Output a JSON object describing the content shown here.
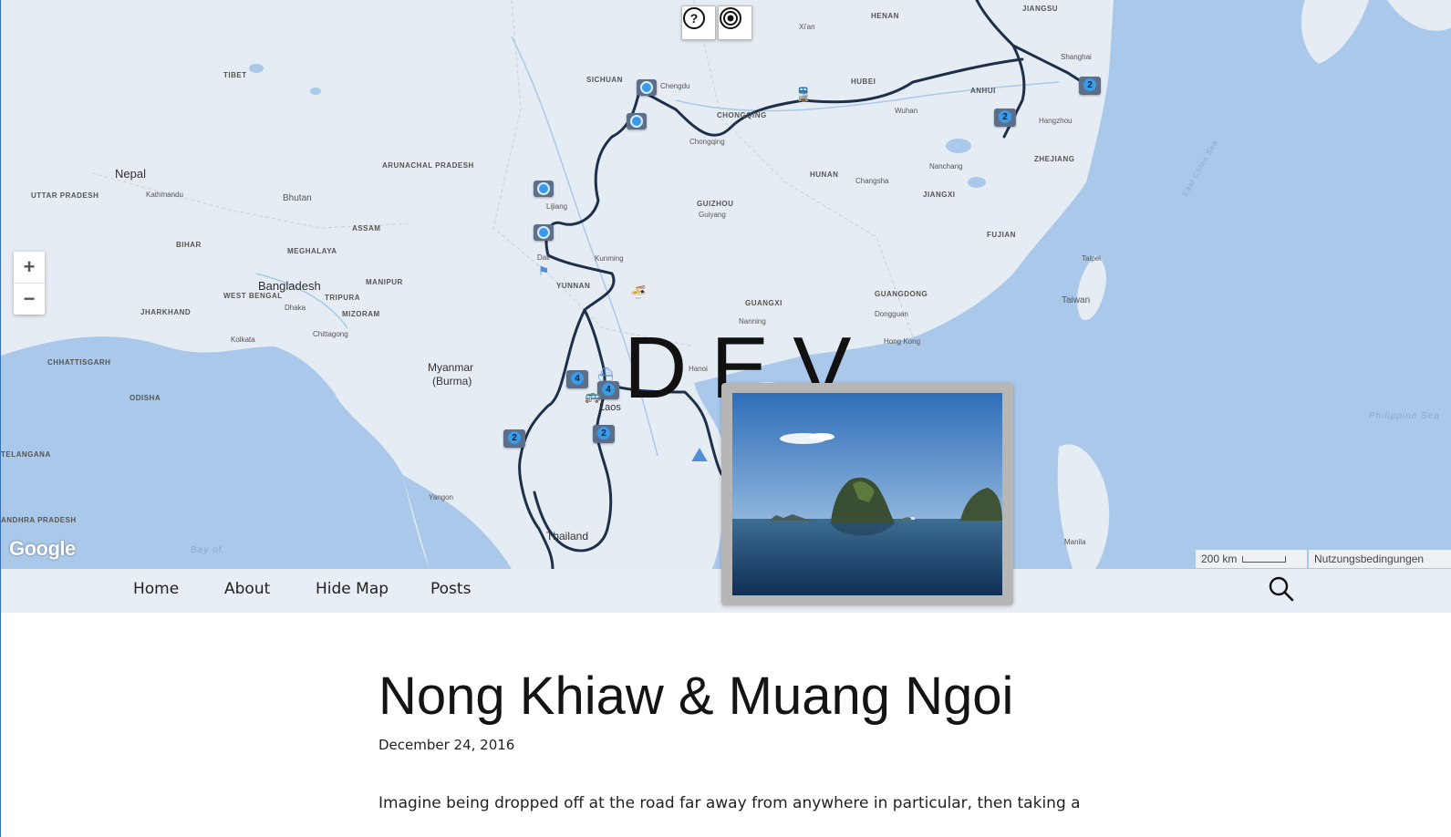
{
  "map": {
    "countries": [
      "Nepal",
      "Bhutan",
      "Bangladesh",
      "Myanmar",
      "(Burma)",
      "Thailand",
      "Laos",
      "Taiwan"
    ],
    "regions": [
      "TIBET",
      "SICHUAN",
      "HENAN",
      "HUBEI",
      "ANHUI",
      "JIANGSU",
      "ZHEJIANG",
      "JIANGXI",
      "HUNAN",
      "FUJIAN",
      "GUIZHOU",
      "YUNNAN",
      "GUANGXI",
      "GUANGDONG",
      "CHONGQING",
      "UTTAR PRADESH",
      "BIHAR",
      "JHARKHAND",
      "WEST BENGAL",
      "ODISHA",
      "CHHATTISGARH",
      "ARUNACHAL PRADESH",
      "ASSAM",
      "MEGHALAYA",
      "MANIPUR",
      "MIZORAM",
      "TRIPURA",
      "ANDHRA PRADESH",
      "TELANGANA"
    ],
    "cities": [
      "Kathmandu",
      "Dhaka",
      "Kolkata",
      "Chittagong",
      "Kunming",
      "Chongqing",
      "Wuhan",
      "Changsha",
      "Nanchang",
      "Hangzhou",
      "Guiyang",
      "Nanning",
      "Hanoi",
      "Hong Kong",
      "Dongguan",
      "Taipei",
      "Yangon",
      "Manila",
      "Chengdu",
      "Shanghai",
      "Xi'an",
      "Lijiang",
      "Dali"
    ],
    "seas": [
      "Bay of",
      "Philippine Sea",
      "East China Sea"
    ],
    "cluster_counts": [
      "2",
      "2",
      "4",
      "4",
      "2",
      "2"
    ],
    "controls": {
      "help_icon": "question-circle-icon",
      "locate_icon": "target-icon",
      "zoom_in": "+",
      "zoom_out": "−"
    },
    "google_logo": "Google",
    "scale_label": "200 km",
    "terms_label": "Nutzungsbedingungen"
  },
  "site": {
    "title": "DEV"
  },
  "nav": {
    "items": [
      "Home",
      "About",
      "Hide Map",
      "Posts"
    ],
    "search_icon": "search-icon"
  },
  "post": {
    "title": "Nong Khiaw & Muang Ngoi",
    "date": "December 24, 2016",
    "excerpt": "Imagine being dropped off at the road far away from anywhere in particular, then taking a"
  },
  "colors": {
    "land": "#e6ecf3",
    "water": "#a9c8ea",
    "route": "#1e2f4a",
    "accent": "#3b9be8",
    "navbar": "#e8eef5"
  }
}
